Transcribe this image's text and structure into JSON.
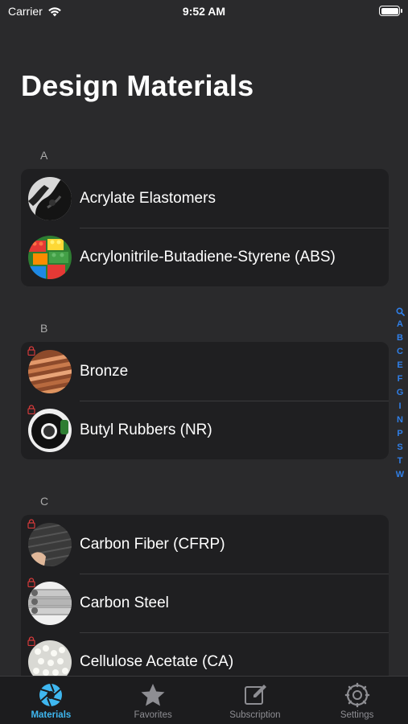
{
  "status": {
    "carrier": "Carrier",
    "time": "9:52 AM"
  },
  "title": "Design Materials",
  "sections": [
    {
      "letter": "A",
      "items": [
        {
          "label": "Acrylate Elastomers",
          "locked": false,
          "thumb": "black-rubber"
        },
        {
          "label": "Acrylonitrile-Butadiene-Styrene (ABS)",
          "locked": false,
          "thumb": "lego-bricks"
        }
      ]
    },
    {
      "letter": "B",
      "items": [
        {
          "label": "Bronze",
          "locked": true,
          "thumb": "bronze-rods"
        },
        {
          "label": "Butyl Rubbers (NR)",
          "locked": true,
          "thumb": "tape-roll"
        }
      ]
    },
    {
      "letter": "C",
      "items": [
        {
          "label": "Carbon Fiber (CFRP)",
          "locked": true,
          "thumb": "carbon-weave"
        },
        {
          "label": "Carbon Steel",
          "locked": true,
          "thumb": "steel-tubes"
        },
        {
          "label": "Cellulose Acetate (CA)",
          "locked": true,
          "thumb": "pellets"
        }
      ]
    }
  ],
  "index_letters": [
    "A",
    "B",
    "C",
    "E",
    "F",
    "G",
    "I",
    "N",
    "P",
    "S",
    "T",
    "W"
  ],
  "tabs": [
    {
      "label": "Materials",
      "icon": "aperture-icon",
      "active": true
    },
    {
      "label": "Favorites",
      "icon": "star-icon",
      "active": false
    },
    {
      "label": "Subscription",
      "icon": "edit-icon",
      "active": false
    },
    {
      "label": "Settings",
      "icon": "gear-icon",
      "active": false
    }
  ],
  "colors": {
    "background": "#2a2a2c",
    "group": "#1f1f21",
    "accent": "#3fb7f0",
    "index": "#2f7fe8",
    "lock": "#d33a3a"
  }
}
